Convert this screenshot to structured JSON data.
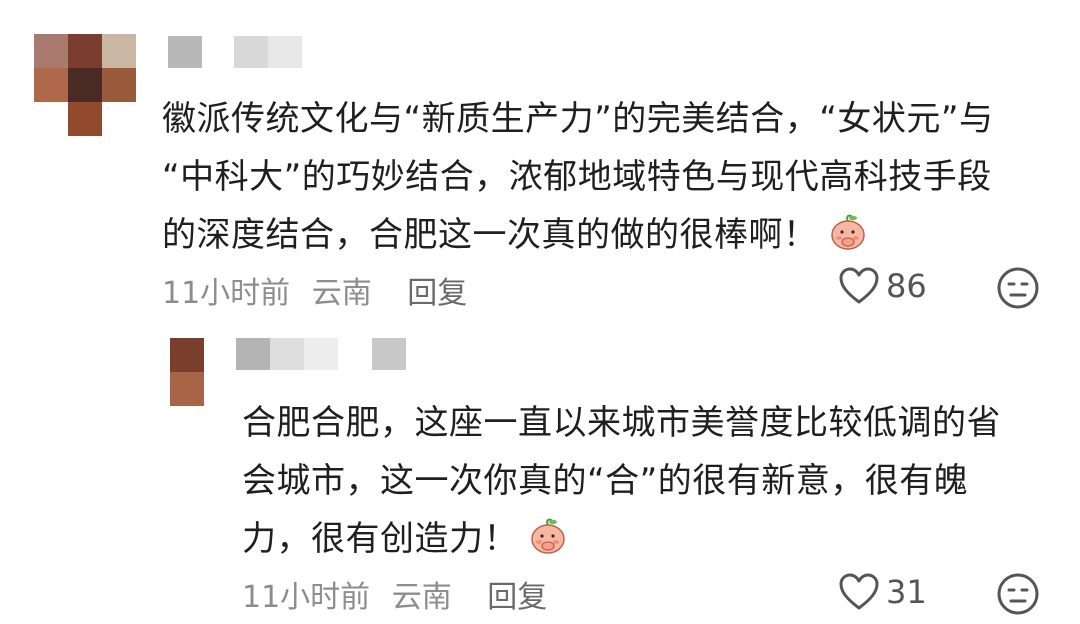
{
  "comments": [
    {
      "text_lines": [
        "徽派传统文化与“新质生产力”的完美结合，“女状元”与",
        "“中科大”的巧妙结合，浓郁地域特色与现代高科技手段",
        "的深度结合，合肥这一次真的做的很棒啊！"
      ],
      "time": "11小时前",
      "location": "云南",
      "reply_label": "回复",
      "likes": "86",
      "emoji": "peach-face-emoji",
      "reply": {
        "text_lines": [
          "合肥合肥，这座一直以来城市美誉度比较低调的省",
          "会城市，这一次你真的“合”的很有新意，很有魄",
          "力，很有创造力！"
        ],
        "time": "11小时前",
        "location": "云南",
        "reply_label": "回复",
        "likes": "31",
        "emoji": "peach-face-emoji"
      }
    }
  ],
  "icons": {
    "like": "heart-outline-icon",
    "dislike": "neutral-face-icon"
  },
  "colors": {
    "text": "#1f1f1f",
    "meta": "#8d8d8d",
    "icon": "#555555"
  }
}
